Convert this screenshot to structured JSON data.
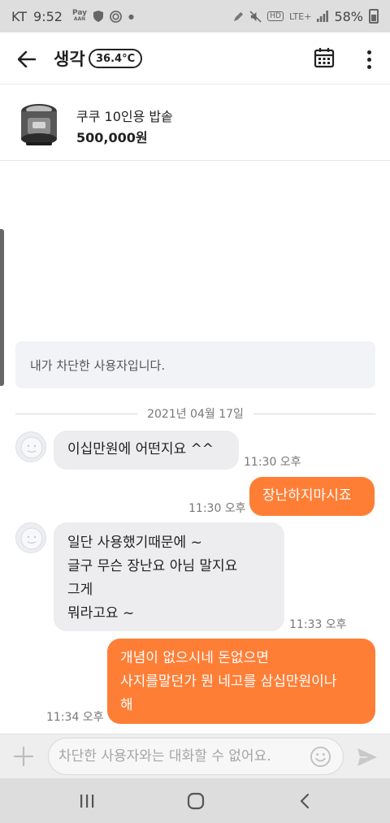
{
  "status_bar": {
    "carrier": "KT",
    "time": "9:52",
    "pay_label_top": "Pay",
    "pay_label_bottom": "AAN",
    "hd_label": "HD",
    "network": "LTE+",
    "battery": "58%"
  },
  "header": {
    "title": "생각",
    "manner_temp": "36.4°C"
  },
  "product": {
    "name": "쿠쿠 10인용 밥솥",
    "price": "500,000원"
  },
  "notice": "내가 차단한 사용자입니다.",
  "date_divider": "2021년 04월 17일",
  "messages": [
    {
      "side": "in",
      "text": "이십만원에   어떤지요 ^^",
      "time": "11:30 오후"
    },
    {
      "side": "out",
      "text": "장난하지마시죠",
      "time": "11:30 오후"
    },
    {
      "side": "in",
      "lines": [
        "일단 사용했기때문에  ~",
        "글구  무슨 장난요  아님 말지요",
        "그게",
        "뭐라고요 ~"
      ],
      "time": "11:33 오후"
    },
    {
      "side": "out",
      "lines": [
        "개념이 없으시네 돈없으면",
        "사지를말던가 뭔 네고를 삼십만원이나",
        "해"
      ],
      "time": "11:34 오후"
    }
  ],
  "input": {
    "placeholder": "차단한 사용자와는 대화할 수 없어요."
  },
  "colors": {
    "accent": "#ff7e36",
    "incoming_bubble": "#ededf0"
  }
}
